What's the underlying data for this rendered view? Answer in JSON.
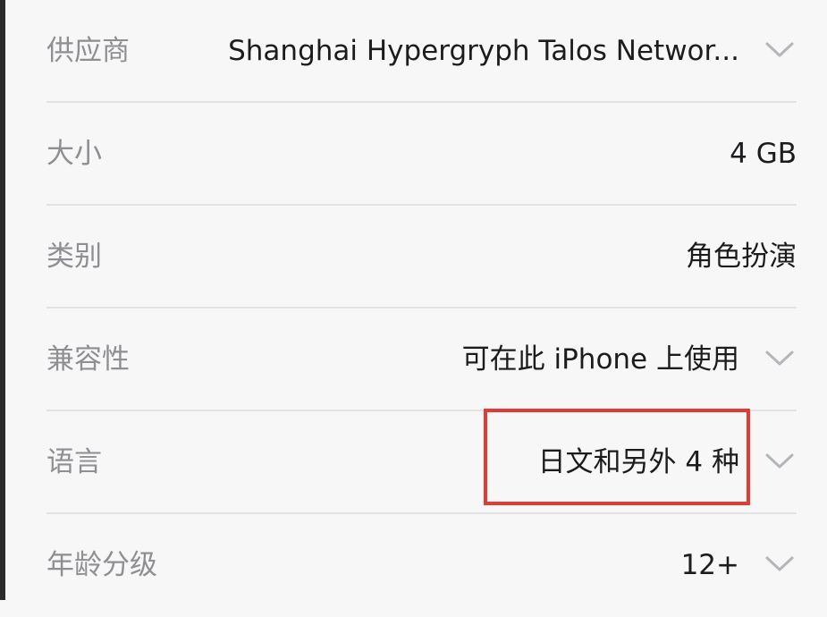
{
  "rows": [
    {
      "label": "供应商",
      "value": "Shanghai Hypergryph Talos Networ...",
      "chevron": true
    },
    {
      "label": "大小",
      "value": "4 GB",
      "chevron": false
    },
    {
      "label": "类别",
      "value": "角色扮演",
      "chevron": false
    },
    {
      "label": "兼容性",
      "value": "可在此 iPhone 上使用",
      "chevron": true
    },
    {
      "label": "语言",
      "value": "日文和另外 4 种",
      "chevron": true
    },
    {
      "label": "年龄分级",
      "value": "12+",
      "chevron": true
    }
  ],
  "icons": {
    "chevron": "chevron-down-icon"
  },
  "colors": {
    "background": "#f7f7f7",
    "label": "#8e8e93",
    "value": "#1c1c1e",
    "divider": "#e3e3e3",
    "chevron": "#b5b5ba",
    "highlight": "#e53935"
  }
}
